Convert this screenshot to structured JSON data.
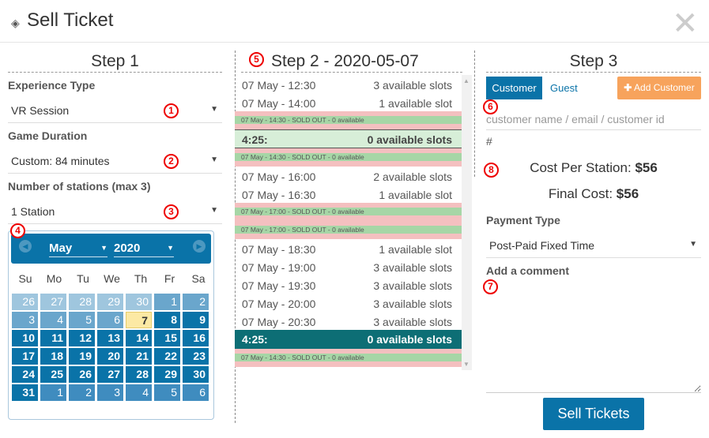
{
  "modal": {
    "title": "Sell Ticket",
    "title_icon": "ticket-icon",
    "close_icon": "close-icon"
  },
  "step1": {
    "heading": "Step 1",
    "experience_type": {
      "label": "Experience Type",
      "value": "VR Session"
    },
    "game_duration": {
      "label": "Game Duration",
      "value": "Custom: 84 minutes"
    },
    "stations": {
      "label": "Number of stations (max 3)",
      "value": "1 Station"
    },
    "calendar": {
      "month": "May",
      "year": "2020",
      "weekdays": [
        "Su",
        "Mo",
        "Tu",
        "We",
        "Th",
        "Fr",
        "Sa"
      ],
      "selected_day": "7",
      "weeks": [
        [
          {
            "d": "26",
            "k": "other"
          },
          {
            "d": "27",
            "k": "other"
          },
          {
            "d": "28",
            "k": "other"
          },
          {
            "d": "29",
            "k": "other"
          },
          {
            "d": "30",
            "k": "other"
          },
          {
            "d": "1",
            "k": "past"
          },
          {
            "d": "2",
            "k": "past"
          }
        ],
        [
          {
            "d": "3",
            "k": "past"
          },
          {
            "d": "4",
            "k": "past"
          },
          {
            "d": "5",
            "k": "past"
          },
          {
            "d": "6",
            "k": "past"
          },
          {
            "d": "7",
            "k": "today"
          },
          {
            "d": "8",
            "k": "avail"
          },
          {
            "d": "9",
            "k": "avail"
          }
        ],
        [
          {
            "d": "10",
            "k": "avail"
          },
          {
            "d": "11",
            "k": "avail"
          },
          {
            "d": "12",
            "k": "avail"
          },
          {
            "d": "13",
            "k": "avail"
          },
          {
            "d": "14",
            "k": "avail"
          },
          {
            "d": "15",
            "k": "avail"
          },
          {
            "d": "16",
            "k": "avail"
          }
        ],
        [
          {
            "d": "17",
            "k": "avail"
          },
          {
            "d": "18",
            "k": "avail"
          },
          {
            "d": "19",
            "k": "avail"
          },
          {
            "d": "20",
            "k": "avail"
          },
          {
            "d": "21",
            "k": "avail"
          },
          {
            "d": "22",
            "k": "avail"
          },
          {
            "d": "23",
            "k": "avail"
          }
        ],
        [
          {
            "d": "24",
            "k": "avail"
          },
          {
            "d": "25",
            "k": "avail"
          },
          {
            "d": "26",
            "k": "avail"
          },
          {
            "d": "27",
            "k": "avail"
          },
          {
            "d": "28",
            "k": "avail"
          },
          {
            "d": "29",
            "k": "avail"
          },
          {
            "d": "30",
            "k": "avail"
          }
        ],
        [
          {
            "d": "31",
            "k": "avail"
          },
          {
            "d": "1",
            "k": "next"
          },
          {
            "d": "2",
            "k": "next"
          },
          {
            "d": "3",
            "k": "next"
          },
          {
            "d": "4",
            "k": "next"
          },
          {
            "d": "5",
            "k": "next"
          },
          {
            "d": "6",
            "k": "next"
          }
        ]
      ]
    }
  },
  "step2": {
    "heading": "Step 2 - 2020-05-07",
    "rows": [
      {
        "type": "slot",
        "time": "07 May - 12:30",
        "avail": "3 available slots"
      },
      {
        "type": "slot",
        "time": "07 May - 14:00",
        "avail": "1 available slot"
      },
      {
        "type": "sold",
        "text": "07 May - 14:30 - SOLD OUT - 0 available"
      },
      {
        "type": "dur_light",
        "time": "4:25:",
        "avail": "0 available slots"
      },
      {
        "type": "sold",
        "text": "07 May - 14:30 - SOLD OUT - 0 available"
      },
      {
        "type": "slot",
        "time": "07 May - 16:00",
        "avail": "2 available slots"
      },
      {
        "type": "slot",
        "time": "07 May - 16:30",
        "avail": "1 available slot"
      },
      {
        "type": "sold",
        "text": "07 May - 17:00 - SOLD OUT - 0 available"
      },
      {
        "type": "sold",
        "text": "07 May - 17:00 - SOLD OUT - 0 available"
      },
      {
        "type": "slot",
        "time": "07 May - 18:30",
        "avail": "1 available slot"
      },
      {
        "type": "slot",
        "time": "07 May - 19:00",
        "avail": "3 available slots"
      },
      {
        "type": "slot",
        "time": "07 May - 19:30",
        "avail": "3 available slots"
      },
      {
        "type": "slot",
        "time": "07 May - 20:00",
        "avail": "3 available slots"
      },
      {
        "type": "slot",
        "time": "07 May - 20:30",
        "avail": "3 available slots"
      },
      {
        "type": "dur_dark",
        "time": "4:25:",
        "avail": "0 available slots"
      },
      {
        "type": "sold",
        "text": "07 May - 14:30 - SOLD OUT - 0 available"
      }
    ]
  },
  "step3": {
    "heading": "Step 3",
    "customer_tab": "Customer",
    "guest_tab": "Guest",
    "add_customer": "Add Customer",
    "customer_placeholder": "customer name / email / customer id",
    "hash": "#",
    "cost_per_station_label": "Cost Per Station:",
    "cost_per_station_value": "$56",
    "final_cost_label": "Final Cost:",
    "final_cost_value": "$56",
    "payment_type": {
      "label": "Payment Type",
      "value": "Post-Paid Fixed Time"
    },
    "comment_label": "Add a comment",
    "sell_button": "Sell Tickets"
  },
  "badges": [
    "1",
    "2",
    "3",
    "4",
    "5",
    "6",
    "7",
    "8"
  ],
  "colors": {
    "primary": "#0a73a8",
    "add_button": "#f7a35c",
    "sold_out": "#f4c0c0",
    "sold_bar": "#a6d6a6",
    "duration_dark": "#0d6e75",
    "badge": "#e00000"
  }
}
